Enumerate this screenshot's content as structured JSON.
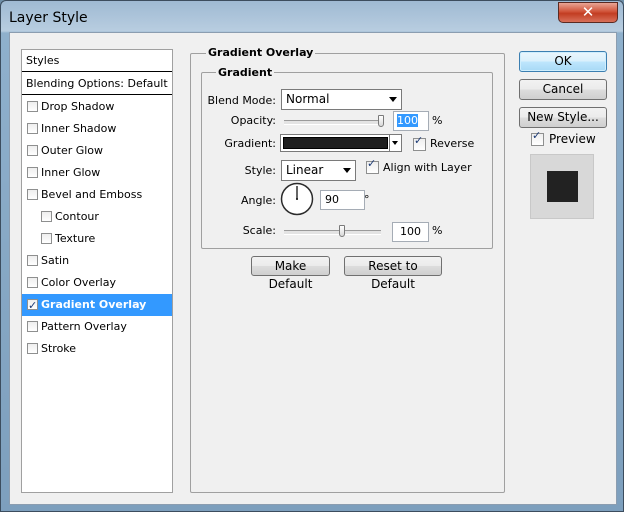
{
  "window": {
    "title": "Layer Style",
    "close_glyph": "✕"
  },
  "styles_panel": {
    "header": "Styles",
    "blending_options": "Blending Options: Default",
    "items": [
      {
        "label": "Drop Shadow",
        "checked": false,
        "indent": false,
        "selected": false
      },
      {
        "label": "Inner Shadow",
        "checked": false,
        "indent": false,
        "selected": false
      },
      {
        "label": "Outer Glow",
        "checked": false,
        "indent": false,
        "selected": false
      },
      {
        "label": "Inner Glow",
        "checked": false,
        "indent": false,
        "selected": false
      },
      {
        "label": "Bevel and Emboss",
        "checked": false,
        "indent": false,
        "selected": false
      },
      {
        "label": "Contour",
        "checked": false,
        "indent": true,
        "selected": false
      },
      {
        "label": "Texture",
        "checked": false,
        "indent": true,
        "selected": false
      },
      {
        "label": "Satin",
        "checked": false,
        "indent": false,
        "selected": false
      },
      {
        "label": "Color Overlay",
        "checked": false,
        "indent": false,
        "selected": false
      },
      {
        "label": "Gradient Overlay",
        "checked": true,
        "indent": false,
        "selected": true
      },
      {
        "label": "Pattern Overlay",
        "checked": false,
        "indent": false,
        "selected": false
      },
      {
        "label": "Stroke",
        "checked": false,
        "indent": false,
        "selected": false
      }
    ]
  },
  "gradient_overlay": {
    "group_title": "Gradient Overlay",
    "subgroup_title": "Gradient",
    "blend_mode": {
      "label": "Blend Mode:",
      "value": "Normal"
    },
    "opacity": {
      "label": "Opacity:",
      "value": "100",
      "unit": "%",
      "level": 1.0
    },
    "gradient": {
      "label": "Gradient:",
      "reverse_label": "Reverse",
      "reverse_checked": true,
      "swatch_color": "#1e1e1e"
    },
    "style": {
      "label": "Style:",
      "value": "Linear",
      "align_label": "Align with Layer",
      "align_checked": true
    },
    "angle": {
      "label": "Angle:",
      "value": "90",
      "unit": "°",
      "degrees": 90
    },
    "scale": {
      "label": "Scale:",
      "value": "100",
      "unit": "%",
      "level": 0.6
    },
    "make_default": "Make Default",
    "reset_default": "Reset to Default"
  },
  "actions": {
    "ok": "OK",
    "cancel": "Cancel",
    "new_style": "New Style...",
    "preview_label": "Preview",
    "preview_checked": true
  },
  "colors": {
    "selection": "#3399ff",
    "preview_swatch": "#222222",
    "field_highlight": "#3399ff"
  }
}
